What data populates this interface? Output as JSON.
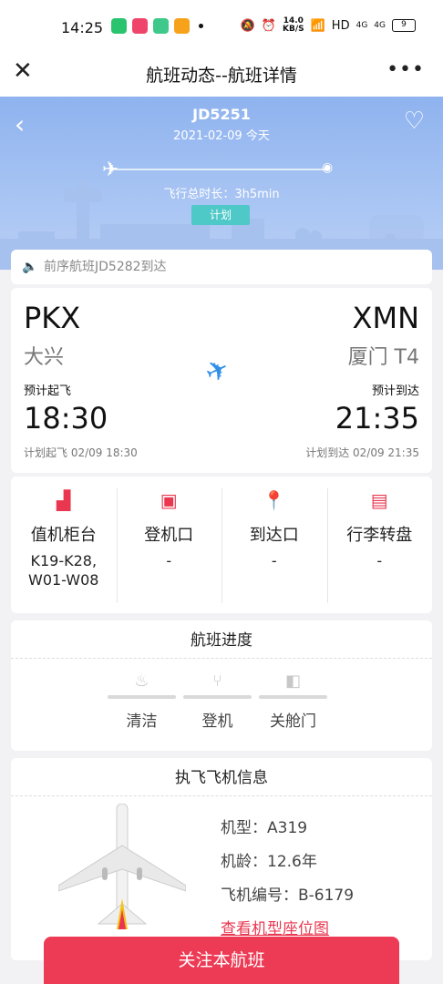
{
  "status_bar": {
    "time": "14:25",
    "speed_value": "14.0",
    "speed_unit": "KB/S",
    "battery": "9",
    "network": "HD",
    "signal1": "4G",
    "signal2": "4G"
  },
  "nav": {
    "title": "航班动态--航班详情"
  },
  "hero": {
    "flight_no": "JD5251",
    "date": "2021-02-09 今天",
    "duration": "飞行总时长：3h5min",
    "status": "计划"
  },
  "notice": {
    "text": "前序航班JD5282到达"
  },
  "route": {
    "dep": {
      "code": "PKX",
      "city": "大兴",
      "label": "预计起飞",
      "time": "18:30",
      "plan": "计划起飞 02/09 18:30"
    },
    "arr": {
      "code": "XMN",
      "city": "厦门 T4",
      "label": "预计到达",
      "time": "21:35",
      "plan": "计划到达 02/09 21:35"
    }
  },
  "facilities": [
    {
      "name": "值机柜台",
      "value": "K19-K28,W01-W08",
      "icon": "checkin-counter-icon"
    },
    {
      "name": "登机口",
      "value": "-",
      "icon": "boarding-gate-icon"
    },
    {
      "name": "到达口",
      "value": "-",
      "icon": "location-pin-icon"
    },
    {
      "name": "行李转盘",
      "value": "-",
      "icon": "luggage-icon"
    }
  ],
  "progress": {
    "title": "航班进度",
    "steps": [
      {
        "name": "清洁",
        "icon": "cleaning-icon"
      },
      {
        "name": "登机",
        "icon": "seat-icon"
      },
      {
        "name": "关舱门",
        "icon": "door-icon"
      }
    ]
  },
  "aircraft": {
    "title": "执飞飞机信息",
    "model": "机型：A319",
    "age": "机龄：12.6年",
    "reg": "飞机编号：B-6179",
    "seatmap_link": "查看机型座位图"
  },
  "follow_button": "关注本航班",
  "colors": {
    "accent": "#ee3b55",
    "hero_top": "#8fb3ef",
    "status_tag": "#4fc8c8",
    "plane_blue": "#2f8fe8"
  }
}
